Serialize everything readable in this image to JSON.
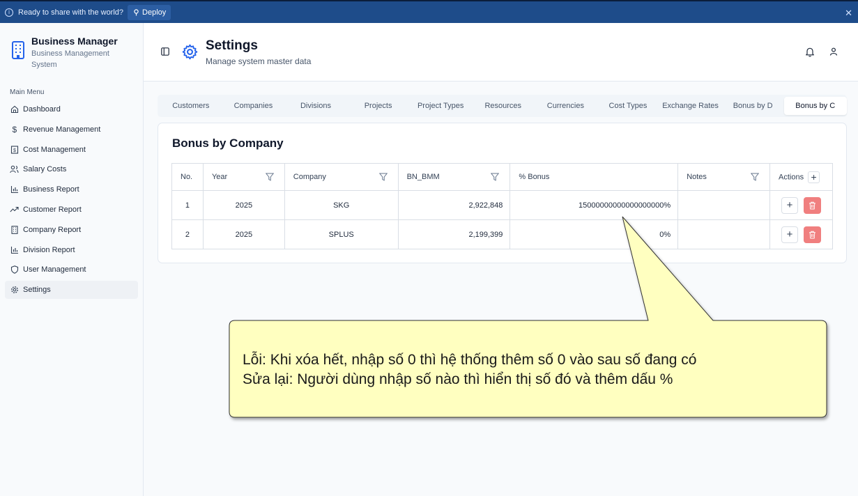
{
  "topbar": {
    "message": "Ready to share with the world?",
    "deploy_label": "Deploy"
  },
  "sidebar": {
    "brand_title": "Business Manager",
    "brand_subtitle": "Business Management System",
    "menu_label": "Main Menu",
    "items": [
      {
        "label": "Dashboard",
        "icon": "home-icon"
      },
      {
        "label": "Revenue Management",
        "icon": "dollar-icon"
      },
      {
        "label": "Cost Management",
        "icon": "receipt-icon"
      },
      {
        "label": "Salary Costs",
        "icon": "users-icon"
      },
      {
        "label": "Business Report",
        "icon": "bar-chart-icon"
      },
      {
        "label": "Customer Report",
        "icon": "trending-up-icon"
      },
      {
        "label": "Company Report",
        "icon": "building-icon"
      },
      {
        "label": "Division Report",
        "icon": "bar-chart-icon"
      },
      {
        "label": "User Management",
        "icon": "shield-icon"
      },
      {
        "label": "Settings",
        "icon": "gear-icon",
        "active": true
      }
    ]
  },
  "header": {
    "title": "Settings",
    "subtitle": "Manage system master data"
  },
  "tabs": [
    "Customers",
    "Companies",
    "Divisions",
    "Projects",
    "Project Types",
    "Resources",
    "Currencies",
    "Cost Types",
    "Exchange Rates",
    "Bonus by D",
    "Bonus by C"
  ],
  "active_tab": "Bonus by C",
  "card": {
    "title": "Bonus by Company",
    "columns": [
      "No.",
      "Year",
      "Company",
      "BN_BMM",
      "% Bonus",
      "Notes",
      "Actions"
    ],
    "rows": [
      {
        "no": "1",
        "year": "2025",
        "company": "SKG",
        "bn_bmm": "2,922,848",
        "bonus": "15000000000000000000%",
        "notes": ""
      },
      {
        "no": "2",
        "year": "2025",
        "company": "SPLUS",
        "bn_bmm": "2,199,399",
        "bonus": "0%",
        "notes": ""
      }
    ]
  },
  "callout": {
    "line1": "Lỗi: Khi xóa hết, nhập số 0 thì hệ thống thêm số 0 vào sau số đang có",
    "line2": "Sửa lại: Người dùng nhập số nào thì hiển thị số đó và thêm dấu %",
    "fill": "#ffffc0"
  }
}
